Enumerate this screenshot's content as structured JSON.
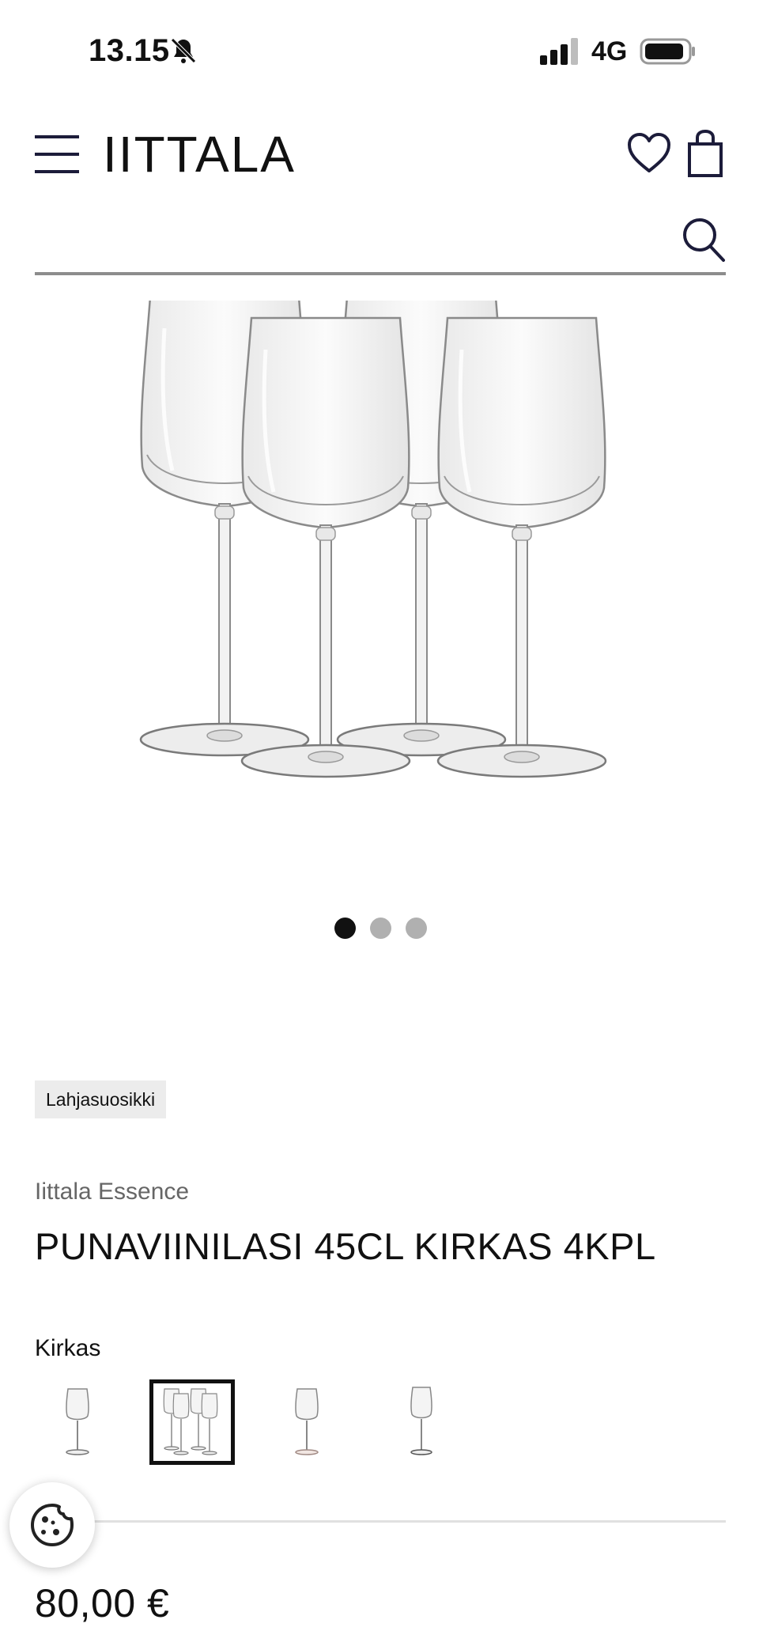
{
  "status_bar": {
    "time": "13.15",
    "network": "4G"
  },
  "header": {
    "logo": "IITTALA",
    "menu_icon": "hamburger-menu-icon",
    "wishlist_icon": "heart-icon",
    "cart_icon": "shopping-bag-icon"
  },
  "search": {
    "placeholder": "",
    "icon": "search-icon"
  },
  "gallery": {
    "slide_count": 3,
    "active_slide": 1
  },
  "product": {
    "badge": "Lahjasuosikki",
    "collection": "Iittala Essence",
    "title": "PUNAVIINILASI 45CL KIRKAS 4KPL",
    "variant_label": "Kirkas",
    "variants_count": 4,
    "selected_variant": 2,
    "price": "80,00 €"
  },
  "cookie": {
    "icon": "cookie-icon"
  }
}
